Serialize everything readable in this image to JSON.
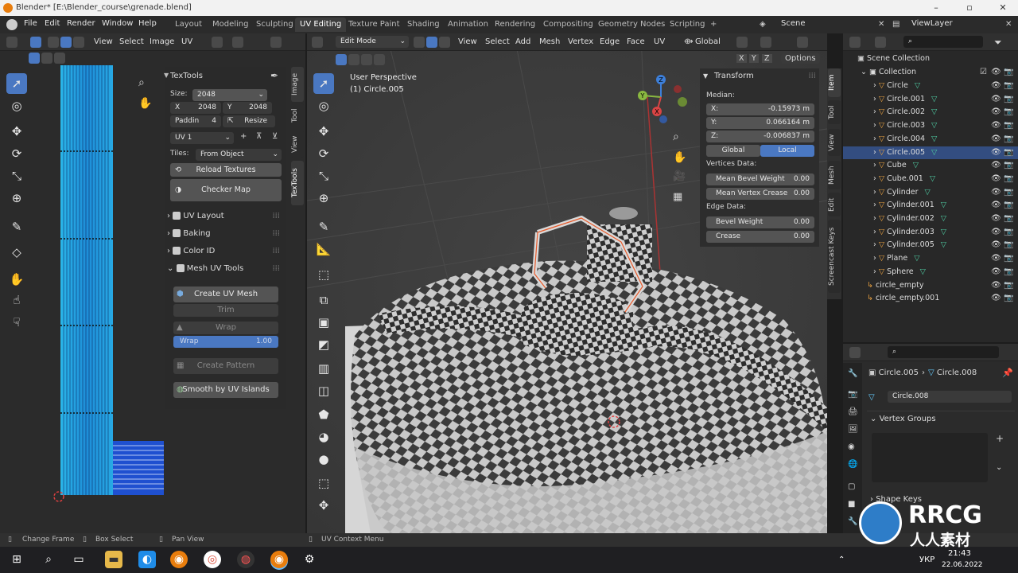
{
  "window": {
    "title": "Blender* [E:\\Blender_course\\grenade.blend]"
  },
  "menu": [
    "File",
    "Edit",
    "Render",
    "Window",
    "Help"
  ],
  "workspaces": [
    "Layout",
    "Modeling",
    "Sculpting",
    "UV Editing",
    "Texture Paint",
    "Shading",
    "Animation",
    "Rendering",
    "Compositing",
    "Geometry Nodes",
    "Scripting"
  ],
  "scene": "Scene",
  "viewlayer": "ViewLayer",
  "uv_header": {
    "view": "View",
    "select": "Select",
    "image": "Image",
    "uv": "UV"
  },
  "textools": {
    "title": "TexTools",
    "size_label": "Size:",
    "size_value": "2048",
    "x_label": "X",
    "x_value": "2048",
    "y_label": "Y",
    "y_value": "2048",
    "padding_label": "Paddin",
    "padding_value": "4",
    "resize": "Resize",
    "uv_channel": "UV 1",
    "tiles_label": "Tiles:",
    "tiles_value": "From Object",
    "reload": "Reload Textures",
    "checker": "Checker Map",
    "sections": [
      "UV Layout",
      "Baking",
      "Color ID",
      "Mesh UV Tools"
    ],
    "create_uv_mesh": "Create UV Mesh",
    "trim": "Trim",
    "wrap": "Wrap",
    "wrap_field": "Wrap",
    "wrap_value": "1.00",
    "create_pattern": "Create Pattern",
    "smooth": "Smooth by UV Islands"
  },
  "uv_tabs": [
    "Image",
    "Tool",
    "View",
    "TexTools"
  ],
  "viewport_header": {
    "mode": "Edit Mode",
    "items": [
      "View",
      "Select",
      "Add",
      "Mesh",
      "Vertex",
      "Edge",
      "Face",
      "UV"
    ],
    "orientation": "Global",
    "options": "Options",
    "axes": [
      "X",
      "Y",
      "Z"
    ]
  },
  "viewport": {
    "perspective": "User Perspective",
    "object": "(1) Circle.005"
  },
  "gizmo": {
    "x": "X",
    "y": "Y",
    "z": "Z"
  },
  "transform": {
    "title": "Transform",
    "median": "Median:",
    "x_label": "X:",
    "x_value": "-0.15973 m",
    "y_label": "Y:",
    "y_value": "0.066164 m",
    "z_label": "Z:",
    "z_value": "-0.006837 m",
    "global": "Global",
    "local": "Local",
    "vertices_data": "Vertices Data:",
    "mean_bevel_label": "Mean Bevel Weight",
    "mean_bevel_value": "0.00",
    "mean_crease_label": "Mean Vertex Crease",
    "mean_crease_value": "0.00",
    "edge_data": "Edge Data:",
    "bevel_label": "Bevel Weight",
    "bevel_value": "0.00",
    "crease_label": "Crease",
    "crease_value": "0.00"
  },
  "viewport_tabs": [
    "Item",
    "Tool",
    "View",
    "Mesh",
    "Edit",
    "Screencast Keys"
  ],
  "outliner": {
    "scene_collection": "Scene Collection",
    "collection": "Collection",
    "items": [
      "Circle",
      "Circle.001",
      "Circle.002",
      "Circle.003",
      "Circle.004",
      "Circle.005",
      "Cube",
      "Cube.001",
      "Cylinder",
      "Cylinder.001",
      "Cylinder.002",
      "Cylinder.003",
      "Cylinder.005",
      "Plane",
      "Sphere"
    ],
    "empties": [
      "circle_empty",
      "circle_empty.001"
    ]
  },
  "properties": {
    "object": "Circle.005",
    "mesh": "Circle.008",
    "mesh_field": "Circle.008",
    "vertex_groups": "Vertex Groups",
    "shape_keys": "Shape Keys"
  },
  "status": {
    "change_frame": "Change Frame",
    "box_select": "Box Select",
    "pan_view": "Pan View",
    "context_menu": "UV Context Menu"
  },
  "taskbar": {
    "lang": "УКР",
    "time": "21:43",
    "date": "22.06.2022"
  },
  "watermark": {
    "brand": "RRCG",
    "sub": "人人素材"
  },
  "colors": {
    "accent": "#4a78c2",
    "selected": "#334d80",
    "checker_light": "#c8c8c8",
    "checker_dark": "#3a3a3a",
    "uv_island": "#2aa8e0"
  }
}
